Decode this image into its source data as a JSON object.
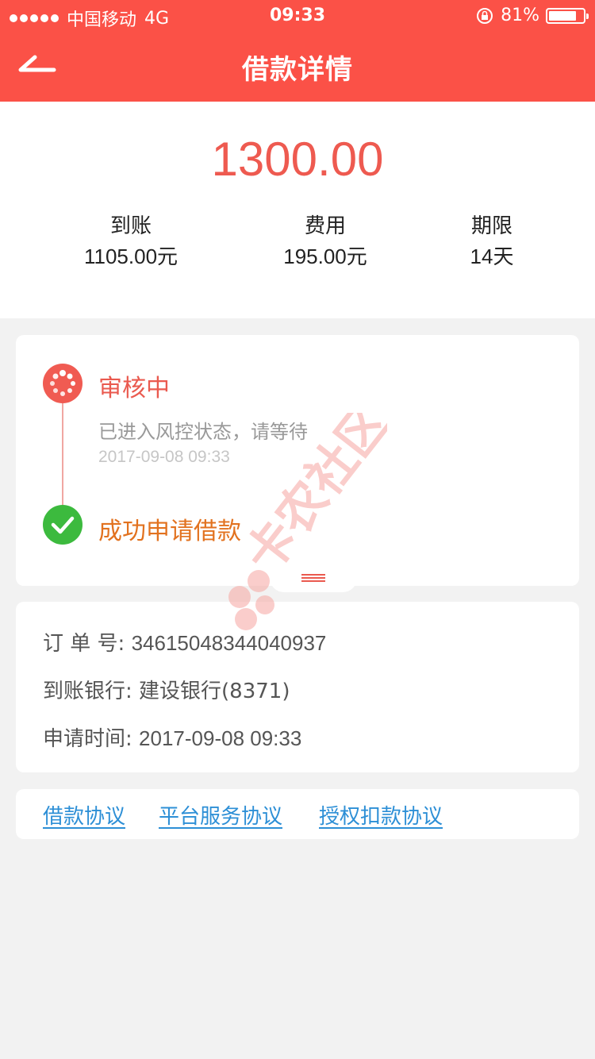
{
  "status_bar": {
    "carrier": "中国移动",
    "network": "4G",
    "time": "09:33",
    "battery_percent": "81%",
    "battery_level": 0.81
  },
  "nav": {
    "title": "借款详情",
    "back_icon": "back-arrow-icon"
  },
  "loan": {
    "amount": "1300.00",
    "stats": [
      {
        "label": "到账",
        "value": "1105.00元"
      },
      {
        "label": "费用",
        "value": "195.00元"
      },
      {
        "label": "期限",
        "value": "14天"
      }
    ]
  },
  "timeline": {
    "steps": [
      {
        "title": "审核中",
        "description": "已进入风控状态，请等待",
        "time": "2017-09-08 09:33",
        "icon": "loading-icon",
        "color": "#f05b52"
      },
      {
        "title": "成功申请借款",
        "icon": "checkmark-icon",
        "color": "#3cba3e"
      }
    ]
  },
  "order": {
    "order_no_label": "订 单 号:",
    "order_no": "34615048344040937",
    "bank_label": "到账银行:",
    "bank": "建设银行(8371)",
    "apply_time_label": "申请时间:",
    "apply_time": "2017-09-08 09:33"
  },
  "agreements": [
    "借款协议",
    "平台服务协议",
    "授权扣款协议"
  ],
  "watermark": {
    "text": "卡农社区"
  },
  "colors": {
    "brand": "#fb5147",
    "amount": "#ee5a50",
    "pending": "#ea5a4f",
    "success_text": "#e2721f",
    "link": "#2d8fd6"
  }
}
